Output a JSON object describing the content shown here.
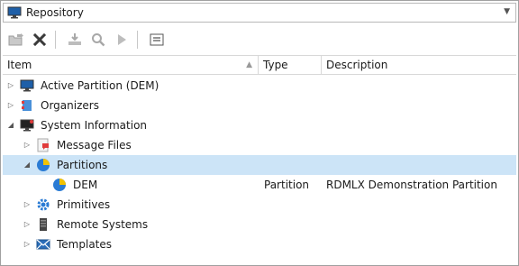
{
  "header": {
    "title": "Repository",
    "icon": "monitor-icon"
  },
  "toolbar": {
    "buttons": [
      {
        "name": "open-folder-icon",
        "enabled": false
      },
      {
        "name": "delete-icon",
        "enabled": true
      },
      {
        "name": "check-in-icon",
        "enabled": false
      },
      {
        "name": "search-icon",
        "enabled": false
      },
      {
        "name": "run-icon",
        "enabled": false
      },
      {
        "name": "properties-icon",
        "enabled": true
      }
    ]
  },
  "columns": {
    "item": "Item",
    "type": "Type",
    "description": "Description"
  },
  "rows": [
    {
      "label": "Active Partition (DEM)",
      "type": "",
      "description": "",
      "level": 0,
      "expander": "collapsed",
      "icon": "monitor-icon",
      "selected": false
    },
    {
      "label": "Organizers",
      "type": "",
      "description": "",
      "level": 0,
      "expander": "collapsed",
      "icon": "organizers-icon",
      "selected": false
    },
    {
      "label": "System Information",
      "type": "",
      "description": "",
      "level": 0,
      "expander": "expanded",
      "icon": "system-info-icon",
      "selected": false
    },
    {
      "label": "Message Files",
      "type": "",
      "description": "",
      "level": 1,
      "expander": "collapsed",
      "icon": "message-files-icon",
      "selected": false
    },
    {
      "label": "Partitions",
      "type": "",
      "description": "",
      "level": 1,
      "expander": "expanded",
      "icon": "partition-icon",
      "selected": true
    },
    {
      "label": "DEM",
      "type": "Partition",
      "description": "RDMLX Demonstration Partition",
      "level": 2,
      "expander": "none",
      "icon": "partition-icon",
      "selected": false
    },
    {
      "label": "Primitives",
      "type": "",
      "description": "",
      "level": 1,
      "expander": "collapsed",
      "icon": "gear-icon",
      "selected": false
    },
    {
      "label": "Remote Systems",
      "type": "",
      "description": "",
      "level": 1,
      "expander": "collapsed",
      "icon": "server-icon",
      "selected": false
    },
    {
      "label": "Templates",
      "type": "",
      "description": "",
      "level": 1,
      "expander": "collapsed",
      "icon": "templates-icon",
      "selected": false
    }
  ]
}
